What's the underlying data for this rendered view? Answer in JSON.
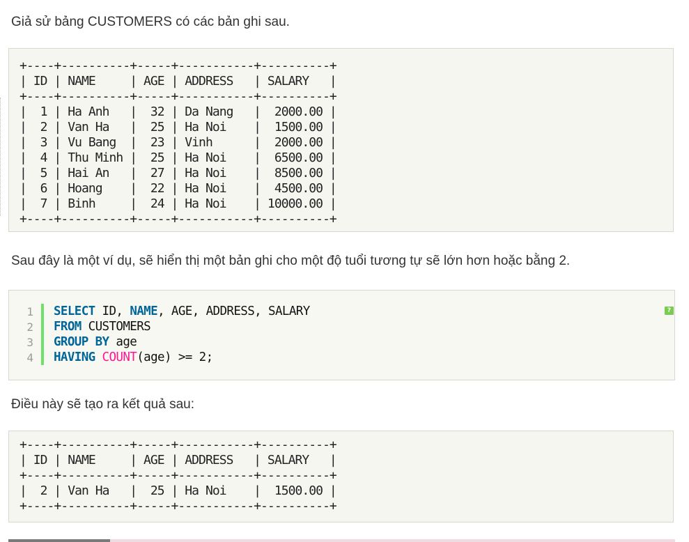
{
  "intro_text": "Giả sử bảng CUSTOMERS có các bản ghi sau.",
  "table1": {
    "border": "+----+----------+-----+-----------+----------+",
    "header": "| ID | NAME     | AGE | ADDRESS   | SALARY   |",
    "rows": [
      "|  1 | Ha Anh   |  32 | Da Nang   |  2000.00 |",
      "|  2 | Van Ha   |  25 | Ha Noi    |  1500.00 |",
      "|  3 | Vu Bang  |  23 | Vinh      |  2000.00 |",
      "|  4 | Thu Minh |  25 | Ha Noi    |  6500.00 |",
      "|  5 | Hai An   |  27 | Ha Noi    |  8500.00 |",
      "|  6 | Hoang    |  22 | Ha Noi    |  4500.00 |",
      "|  7 | Binh     |  24 | Ha Noi    | 10000.00 |"
    ]
  },
  "example_text": "Sau đây là một ví dụ, sẽ hiển thị một bản ghi cho một độ tuổi tương tự sẽ lớn hơn hoặc bằng 2.",
  "code": {
    "line_numbers": [
      "1",
      "2",
      "3",
      "4"
    ],
    "line1": {
      "kw1": "SELECT",
      "t1": " ID, ",
      "kw2": "NAME",
      "t2": ", AGE, ADDRESS, SALARY"
    },
    "line2": {
      "kw1": "FROM",
      "t1": " CUSTOMERS"
    },
    "line3": {
      "kw1": "GROUP BY",
      "t1": " age"
    },
    "line4": {
      "kw1": "HAVING",
      "fn": " COUNT",
      "t1": "(age) >= 2;"
    },
    "help_icon": "?",
    "colors": {
      "keyword": "#006699",
      "function": "#ff1493",
      "gutter": "#6ce26c"
    }
  },
  "result_text": "Điều này sẽ tạo ra kết quả sau:",
  "table2": {
    "border": "+----+----------+-----+-----------+----------+",
    "header": "| ID | NAME     | AGE | ADDRESS   | SALARY   |",
    "rows": [
      "|  2 | Van Ha   |  25 | Ha Noi    |  1500.00 |"
    ]
  }
}
